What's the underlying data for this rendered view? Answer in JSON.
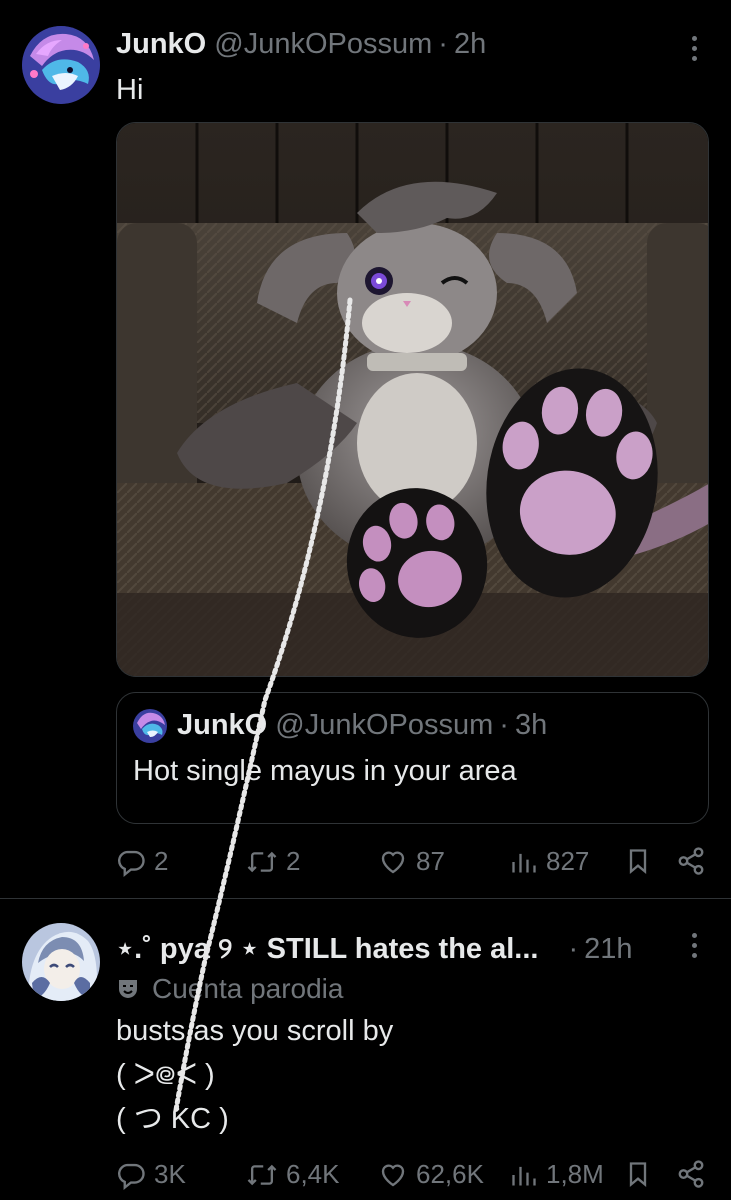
{
  "tweet1": {
    "display_name": "JunkO",
    "handle": "@JunkOPossum",
    "separator": "·",
    "time": "2h",
    "text": "Hi",
    "media_alt": "3D render of a grey cat character lying on a couch showing pink paw pads",
    "quote": {
      "display_name": "JunkO",
      "handle": "@JunkOPossum",
      "separator": "·",
      "time": "3h",
      "text": "Hot single mayus in your area"
    },
    "stats": {
      "replies": "2",
      "reposts": "2",
      "likes": "87",
      "views": "827"
    }
  },
  "tweet2": {
    "display_name": "⋆.˚ pya ୨ ⋆ STILL hates the al...",
    "separator": "·",
    "time": "21h",
    "badge": "Cuenta parodia",
    "line1": "busts as you scroll by",
    "line2": "( ᐳ᪤ᐸ )",
    "line3": "( つ ƘC )",
    "stats": {
      "replies": "3K",
      "reposts": "6,4K",
      "likes": "62,6K",
      "views": "1,8M"
    }
  },
  "icons": {
    "reply": "reply-icon",
    "repost": "repost-icon",
    "like": "like-icon",
    "views": "views-icon",
    "bookmark": "bookmark-icon",
    "share": "share-icon",
    "more": "more-icon",
    "parody": "parody-mask-icon"
  },
  "colors": {
    "background": "#000000",
    "text": "#e7e9ea",
    "secondary": "#71767b",
    "border": "#2f3336"
  }
}
